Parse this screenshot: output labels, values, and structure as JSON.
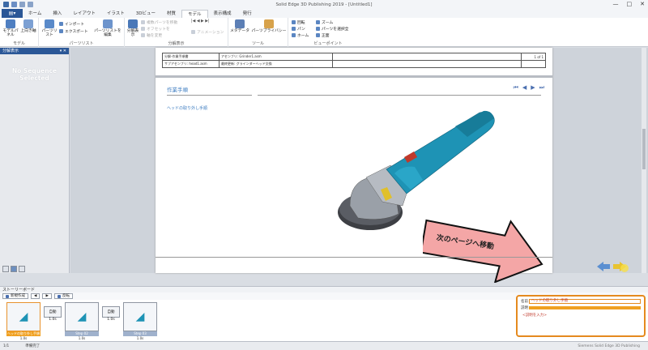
{
  "window": {
    "title": "Solid Edge 3D Publishing 2019 - [Untitled1]",
    "minimize": "—",
    "maximize": "□",
    "close": "✕"
  },
  "tabs": [
    "ホーム",
    "挿入",
    "レイアウト",
    "イラスト",
    "3Dビュー",
    "材質",
    "モデル",
    "表示構成",
    "発行"
  ],
  "active_tab": "モデル",
  "ribbon": {
    "model_group": {
      "label": "モデル",
      "btn_model_panel": "モデルパネル",
      "btn_align": "上向き軸"
    },
    "partslist_group": {
      "label": "パーツリスト",
      "btn_partslist": "パーツリスト",
      "btn_import": "インポート",
      "btn_export": "エクスポート",
      "btn_edit": "パーツリストを編集"
    },
    "explode_group": {
      "label": "分解表示",
      "btn_explode": "分解表示",
      "item_move": "複数パーツを移動",
      "item_offset": "オフセットを",
      "item_axis": "軸を変更",
      "btn_animation": "アニメーション"
    },
    "tool_group": {
      "label": "ツール",
      "btn_metadata": "メタデータ",
      "btn_privacy": "パーツプライバシー"
    },
    "view_group": {
      "label": "ビューポイント",
      "item_rotate": "回転",
      "item_pan": "パン",
      "item_home": "ホーム",
      "item_zoom": "ズーム",
      "item_zoomfit": "パーツを選択全",
      "item_front": "正面"
    }
  },
  "left_panel": {
    "header": "分解表示",
    "empty_text_1": "No Sequence",
    "empty_text_2": "Selected"
  },
  "document": {
    "table": [
      [
        "分解-作業手順書",
        "アセンブリ: Grinder1.asm",
        "",
        "1 of 1"
      ],
      [
        "サブアセンブリ: head1.asm",
        "最終更新: グラインダーヘッド交換",
        "",
        ""
      ]
    ],
    "section_title": "作業手順",
    "step_text": "ヘッドの取り外し手順",
    "callout": "次のページへ移動"
  },
  "storyboard": {
    "header": "ストーリーボード",
    "btn_new": "新規作成",
    "btn_reverse": "反転",
    "cards": [
      {
        "label": "ヘッドの取り外し手順",
        "time": "1.0s",
        "selected": true
      },
      {
        "label": "Step 02",
        "time": "1.0s",
        "selected": false
      },
      {
        "label": "Step 03",
        "time": "1.0s",
        "selected": false
      }
    ],
    "transitions": [
      {
        "label": "自動",
        "time": "1.0s"
      },
      {
        "label": "自動",
        "time": "1.0s"
      }
    ]
  },
  "properties": {
    "name_label": "名前",
    "name_value": "ヘッドの取り外し手順",
    "desc_label": "説明",
    "desc_link": "<説明を入力>"
  },
  "status": {
    "page": "1/1",
    "state": "準備完了",
    "right": "Siemens Solid Edge 3D Publishing"
  },
  "colors": {
    "accent": "#2b5797",
    "highlight": "#e58a1f",
    "link": "#3b7bc0"
  }
}
